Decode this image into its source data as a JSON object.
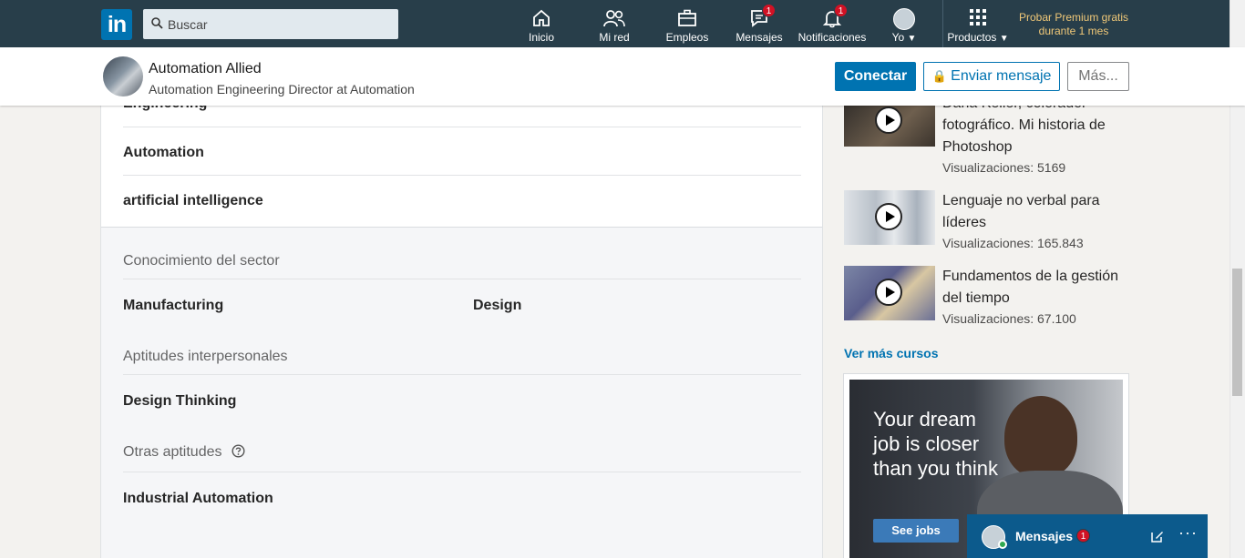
{
  "nav": {
    "logo": "in",
    "search_placeholder": "Buscar",
    "items": [
      {
        "label": "Inicio",
        "icon": "home-icon"
      },
      {
        "label": "Mi red",
        "icon": "network-icon"
      },
      {
        "label": "Empleos",
        "icon": "briefcase-icon"
      },
      {
        "label": "Mensajes",
        "icon": "messaging-icon",
        "badge": "1"
      },
      {
        "label": "Notificaciones",
        "icon": "bell-icon",
        "badge": "1"
      },
      {
        "label": "Yo",
        "icon": "avatar-icon"
      },
      {
        "label": "Productos",
        "icon": "grid-icon"
      }
    ],
    "premium_line1": "Probar Premium gratis",
    "premium_line2": "durante 1 mes"
  },
  "profile": {
    "name": "Automation Allied",
    "headline": "Automation Engineering Director at Automation",
    "connect": "Conectar",
    "message": "Enviar mensaje",
    "more": "Más..."
  },
  "skills": {
    "top_items": [
      "Engineering",
      "Automation",
      "artificial intelligence"
    ],
    "industry_label": "Conocimiento del sector",
    "industry_items": [
      "Manufacturing",
      "Design"
    ],
    "interpersonal_label": "Aptitudes interpersonales",
    "interpersonal_items": [
      "Design Thinking"
    ],
    "other_label": "Otras aptitudes",
    "other_items": [
      "Industrial Automation"
    ]
  },
  "courses": {
    "items": [
      {
        "title": "Dana Keller, colorador fotográfico. Mi historia de Photoshop",
        "views": "Visualizaciones: 5169"
      },
      {
        "title": "Lenguaje no verbal para líderes",
        "views": "Visualizaciones: 165.843"
      },
      {
        "title": "Fundamentos de la gestión del tiempo",
        "views": "Visualizaciones: 67.100"
      }
    ],
    "see_more": "Ver más cursos"
  },
  "ad": {
    "text": "Your dream job is closer than you think",
    "button": "See jobs"
  },
  "messaging": {
    "label": "Mensajes",
    "badge": "1"
  }
}
